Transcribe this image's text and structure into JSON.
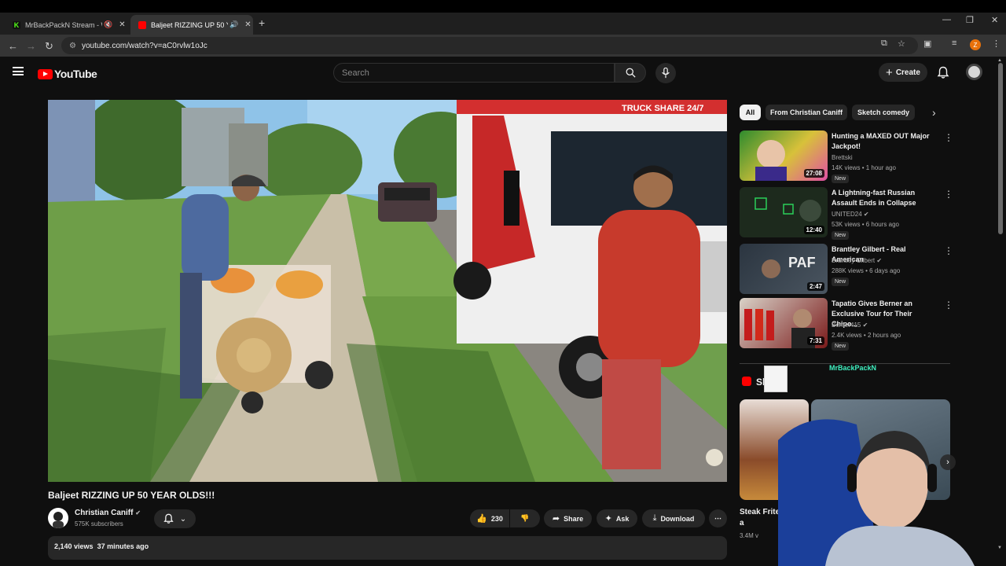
{
  "browser": {
    "tabs": [
      {
        "title": "MrBackPackN Stream - Wat",
        "favicon_color": "#53fc18",
        "favicon_letter": "K",
        "active": false
      },
      {
        "title": "Baljeet RIZZING UP 50 YEAR",
        "favicon_color": "#ff0000",
        "active": true
      }
    ],
    "new_tab": "+",
    "url": "youtube.com/watch?v=aC0rvlw1oJc",
    "profile_initial": "Z"
  },
  "header": {
    "logo_text": "YouTube",
    "search_placeholder": "Search",
    "create_label": "Create"
  },
  "video": {
    "title": "Baljeet RIZZING UP 50 YEAR OLDS!!!",
    "channel": "Christian Caniff",
    "subscribers": "575K subscribers",
    "likes": "230",
    "share_label": "Share",
    "ask_label": "Ask",
    "download_label": "Download",
    "views": "2,140 views",
    "posted": "37 minutes ago",
    "truck_text": "TRUCK SHARE 24/7"
  },
  "chips": [
    "All",
    "From Christian Caniff",
    "Sketch comedy"
  ],
  "recommendations": [
    {
      "title": "Hunting a MAXED OUT Major Jackpot!",
      "channel": "Brettski",
      "verified": false,
      "views": "14K views",
      "age": "1 hour ago",
      "duration": "27:08",
      "badge": "New",
      "thumb_color": "#2e8b2e"
    },
    {
      "title": "A Lightning-fast Russian Assault Ends in Collapse",
      "channel": "UNITED24",
      "verified": true,
      "views": "53K views",
      "age": "6 hours ago",
      "duration": "12:40",
      "badge": "New",
      "thumb_color": "#1d2a1d"
    },
    {
      "title": "Brantley Gilbert - Real American",
      "channel": "Brantley Gilbert",
      "verified": true,
      "views": "288K views",
      "age": "6 days ago",
      "duration": "2:47",
      "badge": "New",
      "thumb_color": "#2b3540"
    },
    {
      "title": "Tapatio Gives Berner an Exclusive Tour for Their Chipo...",
      "channel": "Berner415",
      "verified": true,
      "views": "2.4K views",
      "age": "2 hours ago",
      "duration": "7:31",
      "badge": "New",
      "thumb_color": "#7a1a1a"
    }
  ],
  "shorts": {
    "label": "Sh",
    "first_caption": "Steak Frites with a",
    "first_views": "3.4M v"
  },
  "stream_overlay": {
    "name_tag": "MrBackPackN"
  }
}
